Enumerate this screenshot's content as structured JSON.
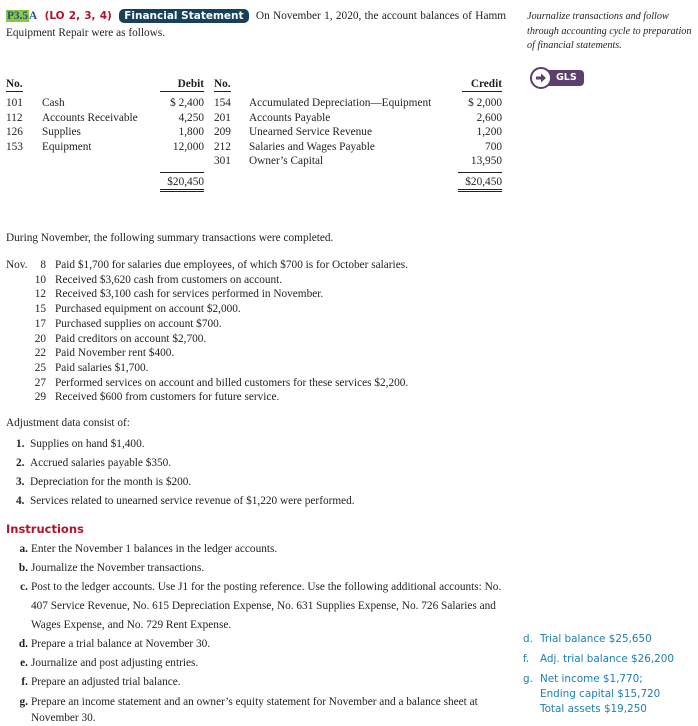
{
  "problem": {
    "number": "P3.5",
    "suffix": "A",
    "learning_objectives": "(LO 2, 3, 4)",
    "badge": "Financial Statement",
    "intro": "On November 1, 2020, the account balances of Hamm Equipment Repair were as follows."
  },
  "sidebar": {
    "note": "Journalize transactions and follow through accounting cycle to preparation of financial statements.",
    "gls_icon": "arrow-right-circle-icon",
    "gls_label": "GLS"
  },
  "balances": {
    "headers": {
      "no": "No.",
      "debit": "Debit",
      "credit": "Credit"
    },
    "debit_accounts": [
      {
        "no": "101",
        "name": "Cash",
        "amount": "$ 2,400"
      },
      {
        "no": "112",
        "name": "Accounts Receivable",
        "amount": "4,250"
      },
      {
        "no": "126",
        "name": "Supplies",
        "amount": "1,800"
      },
      {
        "no": "153",
        "name": "Equipment",
        "amount": "12,000"
      }
    ],
    "credit_accounts": [
      {
        "no": "154",
        "name": "Accumulated Depreciation—Equipment",
        "amount": "$ 2,000"
      },
      {
        "no": "201",
        "name": "Accounts Payable",
        "amount": "2,600"
      },
      {
        "no": "209",
        "name": "Unearned Service Revenue",
        "amount": "1,200"
      },
      {
        "no": "212",
        "name": "Salaries and Wages Payable",
        "amount": "700"
      },
      {
        "no": "301",
        "name": "Owner’s Capital",
        "amount": "13,950"
      }
    ],
    "debit_total": "$20,450",
    "credit_total": "$20,450"
  },
  "transactions": {
    "intro": "During November, the following summary transactions were completed.",
    "month": "Nov.",
    "items": [
      {
        "day": "8",
        "text": "Paid $1,700 for salaries due employees, of which $700 is for October salaries."
      },
      {
        "day": "10",
        "text": "Received $3,620 cash from customers on account."
      },
      {
        "day": "12",
        "text": "Received $3,100 cash for services performed in November."
      },
      {
        "day": "15",
        "text": "Purchased equipment on account $2,000."
      },
      {
        "day": "17",
        "text": "Purchased supplies on account $700."
      },
      {
        "day": "20",
        "text": "Paid creditors on account $2,700."
      },
      {
        "day": "22",
        "text": "Paid November rent $400."
      },
      {
        "day": "25",
        "text": "Paid salaries $1,700."
      },
      {
        "day": "27",
        "text": "Performed services on account and billed customers for these services $2,200."
      },
      {
        "day": "29",
        "text": "Received $600 from customers for future service."
      }
    ]
  },
  "adjustments": {
    "intro": "Adjustment data consist of:",
    "items": [
      {
        "label": "1.",
        "text": "Supplies on hand $1,400."
      },
      {
        "label": "2.",
        "text": "Accrued salaries payable $350."
      },
      {
        "label": "3.",
        "text": "Depreciation for the month is $200."
      },
      {
        "label": "4.",
        "text": "Services related to unearned service revenue of $1,220 were performed."
      }
    ]
  },
  "instructions": {
    "heading": "Instructions",
    "items": [
      {
        "label": "a.",
        "text": "Enter the November 1 balances in the ledger accounts."
      },
      {
        "label": "b.",
        "text": "Journalize the November transactions."
      },
      {
        "label": "c.",
        "text": "Post to the ledger accounts. Use J1 for the posting reference. Use the following additional accounts: No. 407 Service Revenue, No. 615 Depreciation Expense, No. 631 Supplies Expense, No. 726 Salaries and Wages Expense, and No. 729 Rent Expense."
      },
      {
        "label": "d.",
        "text": "Prepare a trial balance at November 30."
      },
      {
        "label": "e.",
        "text": "Journalize and post adjusting entries."
      },
      {
        "label": "f.",
        "text": "Prepare an adjusted trial balance."
      },
      {
        "label": "g.",
        "text": "Prepare an income statement and an owner’s equity statement for November and a balance sheet at November 30."
      }
    ]
  },
  "answers": [
    {
      "label": "d.",
      "lines": [
        "Trial balance $25,650"
      ]
    },
    {
      "label": "f.",
      "lines": [
        "Adj. trial balance $26,200"
      ]
    },
    {
      "label": "g.",
      "lines": [
        "Net income $1,770;",
        "Ending capital $15,720",
        "Total assets $19,250"
      ]
    }
  ],
  "colors": {
    "problem_highlight": "#8dc63f",
    "lo_red": "#b5132b",
    "badge_navy": "#17405c",
    "gls_purple": "#5b3f6e",
    "answer_blue": "#1a7fb0"
  }
}
